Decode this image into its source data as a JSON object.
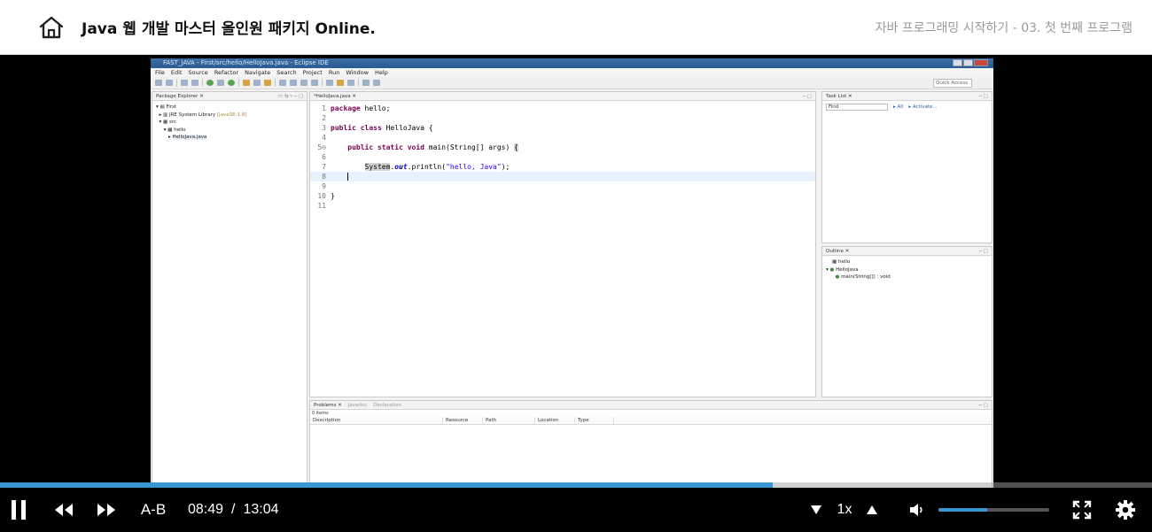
{
  "header": {
    "course_title": "Java 웹 개발 마스터 올인원 패키지 Online.",
    "lesson_title": "자바 프로그래밍 시작하기 - 03. 첫 번째 프로그램"
  },
  "eclipse": {
    "window_title": "FAST_JAVA - First/src/hello/HelloJava.java - Eclipse IDE",
    "menu": [
      "File",
      "Edit",
      "Source",
      "Refactor",
      "Navigate",
      "Search",
      "Project",
      "Run",
      "Window",
      "Help"
    ],
    "quick_access": "Quick Access",
    "package_explorer": {
      "tab": "Package Explorer",
      "items": [
        "First",
        "JRE System Library",
        "[JavaSE-1.8]",
        "src",
        "hello",
        "HelloJava.java"
      ]
    },
    "editor": {
      "tab": "*HelloJava.java",
      "lines": [
        {
          "n": "1",
          "text": "package hello;"
        },
        {
          "n": "2",
          "text": ""
        },
        {
          "n": "3",
          "text": "public class HelloJava {"
        },
        {
          "n": "4",
          "text": ""
        },
        {
          "n": "5⊖",
          "text": "    public static void main(String[] args) {"
        },
        {
          "n": "6",
          "text": ""
        },
        {
          "n": "7",
          "text": "        System.out.println(\"hello, Java\");"
        },
        {
          "n": "8",
          "text": ""
        },
        {
          "n": "9",
          "text": ""
        },
        {
          "n": "10",
          "text": "}"
        },
        {
          "n": "11",
          "text": ""
        }
      ]
    },
    "task_list": {
      "tab": "Task List",
      "find": "Find",
      "all": "All",
      "activate": "Activate..."
    },
    "outline": {
      "tab": "Outline",
      "items": [
        "hello",
        "HelloJava",
        "main(String[]) : void"
      ]
    },
    "problems": {
      "tabs": [
        "Problems",
        "Javadoc",
        "Declaration"
      ],
      "summary": "0 items",
      "columns": [
        "Description",
        "Resource",
        "Path",
        "Location",
        "Type"
      ]
    }
  },
  "player": {
    "progress": 0.671,
    "ab_label": "A-B",
    "current_time": "08:49",
    "separator": "/",
    "total_time": "13:04",
    "speed": "1x",
    "volume": 0.44,
    "colors": {
      "accent": "#3a97d4"
    }
  }
}
